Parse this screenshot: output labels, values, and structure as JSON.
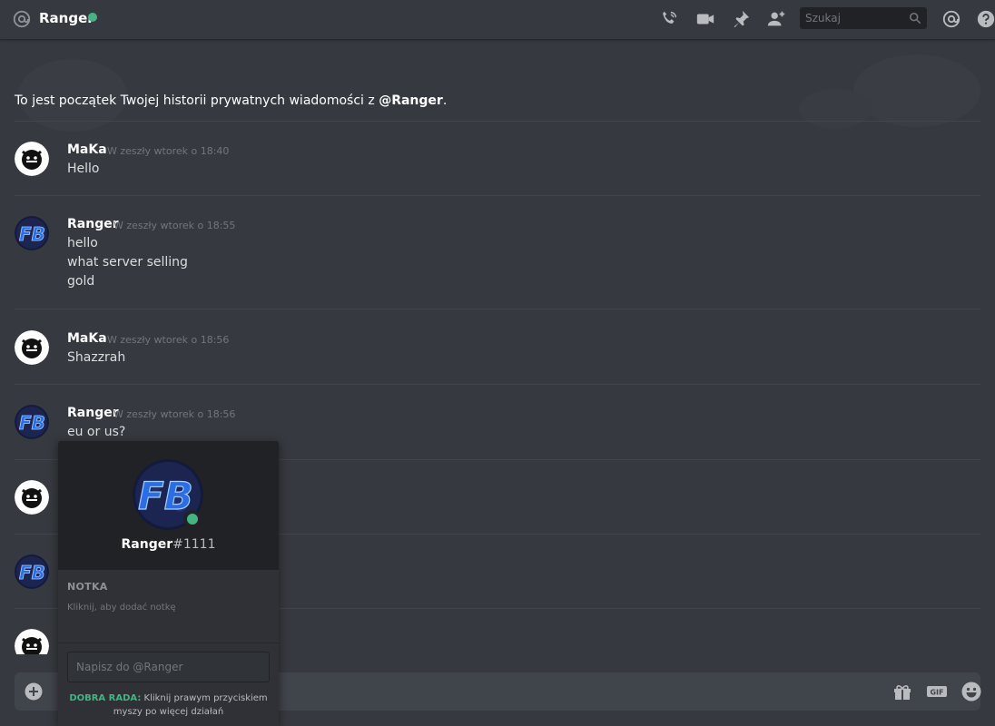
{
  "header": {
    "title": "Ranger",
    "search_placeholder": "Szukaj",
    "icons": [
      "at-icon",
      "call-icon",
      "video-icon",
      "pin-icon",
      "add-friend-icon",
      "search-icon",
      "mention-icon",
      "help-icon"
    ],
    "online_color": "#43b581"
  },
  "intro": {
    "text": "To jest początek Twojej historii prywatnych wiadomości z ",
    "mention": "@Ranger",
    "end": "."
  },
  "messages": [
    {
      "author": "MaKa",
      "time": "W zeszły wtorek o 18:40",
      "lines": [
        "Hello"
      ],
      "avatar": "maka-avatar"
    },
    {
      "author": "Ranger",
      "time": "W zeszły wtorek o 18:55",
      "lines": [
        "hello",
        "what server selling",
        "gold"
      ],
      "avatar": "ranger-avatar"
    },
    {
      "author": "MaKa",
      "time": "W zeszły wtorek o 18:56",
      "lines": [
        "Shazzrah"
      ],
      "avatar": "maka-avatar"
    },
    {
      "author": "Ranger",
      "time": "W zeszły wtorek o 18:56",
      "lines": [
        "eu or us?"
      ],
      "avatar": "ranger-avatar"
    }
  ],
  "popout": {
    "name": "Ranger",
    "discriminator": "#1111",
    "note_heading": "NOTKA",
    "note_placeholder": "Kliknij, aby dodać notkę",
    "dm_placeholder": "Napisz do @Ranger",
    "tip_label": "DOBRA RADA:",
    "tip_text": " Kliknij prawym przyciskiem myszy po więcej działań"
  },
  "composer": {
    "icons": [
      "add-attachment-icon",
      "gift-icon",
      "gif-icon",
      "emoji-icon"
    ]
  },
  "colors": {
    "background": "#36393f",
    "accent_green": "#43b581",
    "popout_bg": "#2f3136"
  }
}
